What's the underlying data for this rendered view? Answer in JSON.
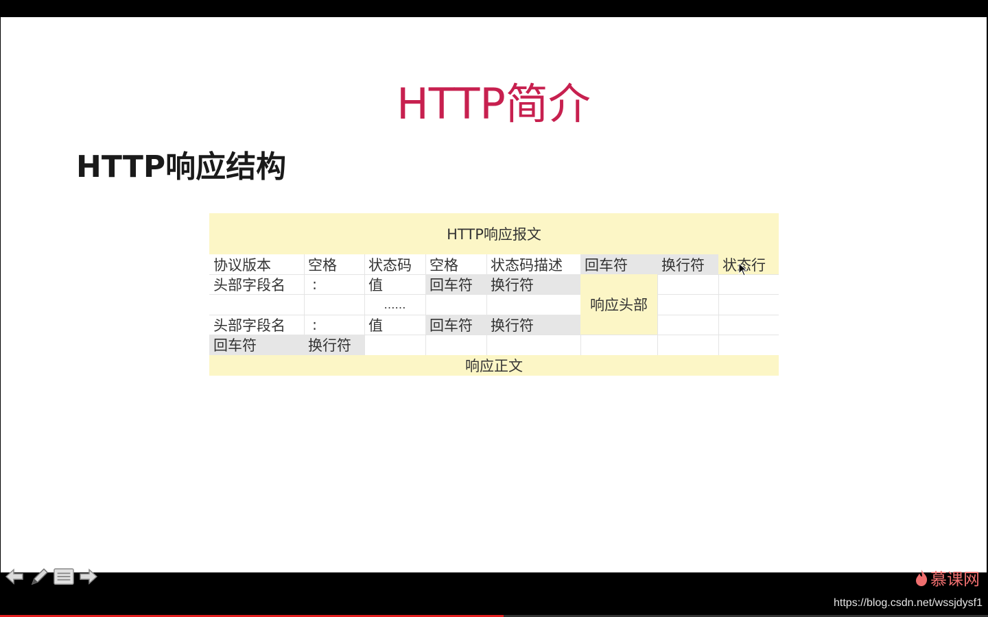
{
  "slide": {
    "title": "HTTP简介",
    "heading": "HTTP响应结构"
  },
  "table": {
    "header": "HTTP响应报文",
    "row1": [
      "协议版本",
      "空格",
      "状态码",
      "空格",
      "状态码描述",
      "回车符",
      "换行符",
      "状态行"
    ],
    "row2": [
      "头部字段名",
      ":",
      "值",
      "回车符",
      "换行符"
    ],
    "ellipsis": "……",
    "row4": [
      "头部字段名",
      ":",
      "值",
      "回车符",
      "换行符"
    ],
    "row5": [
      "回车符",
      "换行符"
    ],
    "response_header": "响应头部",
    "response_body": "响应正文"
  },
  "brand": {
    "name": "慕课网",
    "color": "#ef6f6f"
  },
  "watermark": "https://blog.csdn.net/wssjdysf1",
  "colors": {
    "title": "#c7204f",
    "highlight_yellow": "#fcf6c6",
    "highlight_gray": "#e6e6e6",
    "progress": "#e21f1f"
  },
  "toolbar": {
    "icons": [
      "arrow-left-icon",
      "pen-icon",
      "menu-icon",
      "arrow-right-icon"
    ]
  }
}
